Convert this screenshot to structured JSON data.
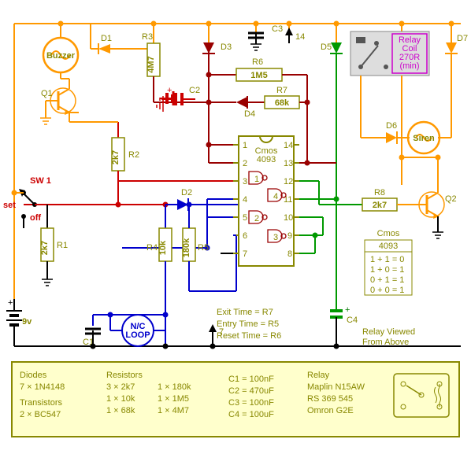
{
  "components": {
    "ic": {
      "name": "Cmos",
      "part": "4093"
    },
    "buzzer": "Buzzer",
    "siren": "Siren",
    "relay_box": {
      "l1": "Relay",
      "l2": "Coil",
      "l3": "270R",
      "l4": "(min)"
    },
    "sw1": "SW 1",
    "sw_set": "set",
    "sw_off": "off",
    "nc_loop_l1": "N/C",
    "nc_loop_l2": "LOOP",
    "battery": "9v",
    "transistors": {
      "q1": "Q1",
      "q2": "Q2"
    },
    "diodes": {
      "d1": "D1",
      "d2": "D2",
      "d3": "D3",
      "d4": "D4",
      "d5": "D5",
      "d6": "D6",
      "d7": "D7"
    },
    "caps": {
      "c1": "C1",
      "c2": "C2",
      "c3": "C3",
      "c4": "C4"
    },
    "resistors": {
      "r1": "R1",
      "r2": "R2",
      "r3": "R3",
      "r4": "R4",
      "r5": "R5",
      "r6": "R6",
      "r7": "R7",
      "r8": "R8",
      "r3_val": "4M7",
      "r6_val": "1M5",
      "r7_val": "68k",
      "r1_val": "2k7",
      "r2_val": "2k7",
      "r4_val": "10k",
      "r5_val": "180k",
      "r8_val": "2k7"
    },
    "pins14": "14",
    "pins7": "7",
    "ic_pins": [
      "1",
      "2",
      "3",
      "4",
      "5",
      "6",
      "7",
      "8",
      "9",
      "10",
      "11",
      "12",
      "13",
      "14"
    ],
    "gate_labels": {
      "g1": "1",
      "g2": "2",
      "g3": "3",
      "g4": "4"
    }
  },
  "notes": {
    "exit": "Exit Time   =  R7",
    "entry": "Entry Time  =  R5",
    "reset": "Reset Time =  R6",
    "relay_view": "Relay Viewed",
    "relay_view2": "From Above"
  },
  "truth_table": {
    "title1": "Cmos",
    "title2": "4093",
    "rows": [
      "1 + 1 = 0",
      "1 + 0 = 1",
      "0 + 1 = 1",
      "0 + 0 = 1"
    ]
  },
  "bom_box": {
    "diodes_h": "Diodes",
    "diodes_l": "7 ×  1N4148",
    "trans_h": "Transistors",
    "trans_l": "2 ×   BC547",
    "res_h": "Resistors",
    "res_c1": [
      "3 ×  2k7",
      "1 ×  10k",
      "1 ×  68k"
    ],
    "res_c2": [
      "1 ×  180k",
      "1 ×  1M5",
      "1 ×  4M7"
    ],
    "caps": [
      "C1 =  100nF",
      "C2 =  470uF",
      "C3 =  100nF",
      "C4 =  100uF"
    ],
    "relay_h": "Relay",
    "relay_l": [
      "Maplin  N15AW",
      "RS        369 545",
      "Omron      G2E"
    ]
  }
}
